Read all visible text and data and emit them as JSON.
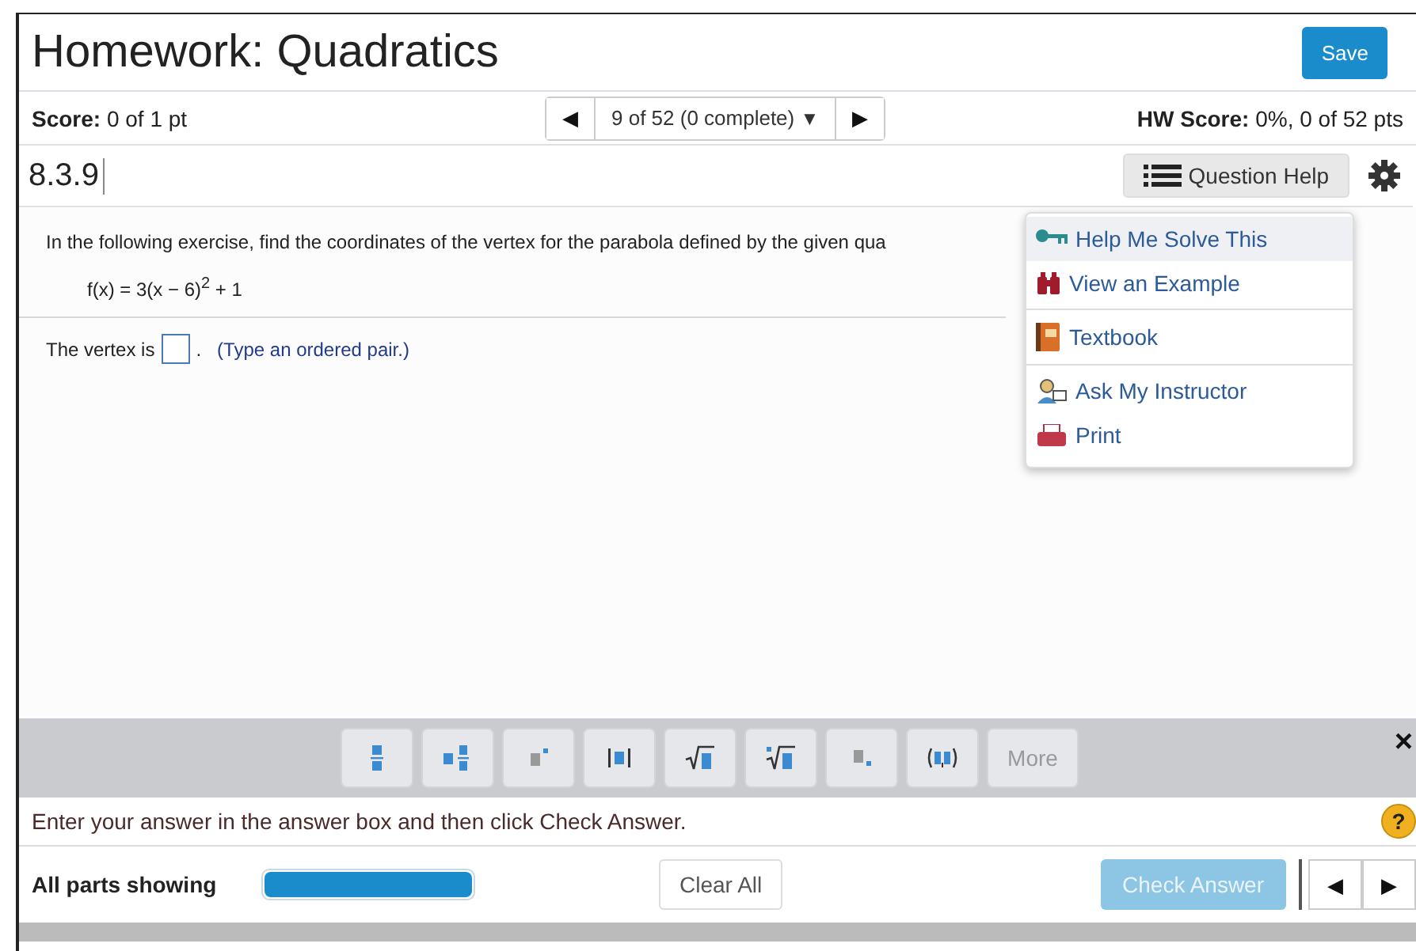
{
  "header": {
    "title": "Homework: Quadratics",
    "save_button": "Save"
  },
  "score_bar": {
    "score_label": "Score:",
    "score_value": "0 of 1 pt",
    "nav_label": "9 of 52 (0 complete)",
    "prev": "◀",
    "next": "▶",
    "dropdown": "▼",
    "hw_label": "HW Score:",
    "hw_value": "0%, 0 of 52 pts"
  },
  "question_bar": {
    "id": "8.3.9",
    "help_button": "Question Help"
  },
  "help_menu": {
    "groups": [
      [
        {
          "kind": "key",
          "label": "Help Me Solve This",
          "selected": true
        },
        {
          "kind": "binoculars",
          "label": "View an Example",
          "selected": false
        }
      ],
      [
        {
          "kind": "book",
          "label": "Textbook",
          "selected": false
        }
      ],
      [
        {
          "kind": "instructor",
          "label": "Ask My Instructor",
          "selected": false
        },
        {
          "kind": "printer",
          "label": "Print",
          "selected": false
        }
      ]
    ]
  },
  "question": {
    "instruction": "In the following exercise, find the coordinates of the vertex for the parabola defined by the given qua",
    "formula": "f(x) = 3(x − 6)$^{2}$ + 1",
    "answer_prefix": "The vertex is",
    "answer_suffix": ".",
    "answer_hint": "(Type an ordered pair.)"
  },
  "math_toolbar": {
    "tools": [
      {
        "kind": "fraction"
      },
      {
        "kind": "mixed-number"
      },
      {
        "kind": "exponent"
      },
      {
        "kind": "absolute-value"
      },
      {
        "kind": "square-root"
      },
      {
        "kind": "nth-root"
      },
      {
        "kind": "subscript"
      },
      {
        "kind": "ordered-pair"
      }
    ],
    "more_button": {
      "label": "More",
      "disabled": true
    },
    "close": "×"
  },
  "instruction_bar": {
    "text": "Enter your answer in the answer box and then click Check Answer.",
    "help": "?"
  },
  "footer": {
    "parts_label": "All parts showing",
    "level": 1,
    "clear_button": "Clear All",
    "check_button": {
      "label": "Check Answer",
      "disabled": true
    },
    "prev": "◀",
    "next": "▶"
  }
}
